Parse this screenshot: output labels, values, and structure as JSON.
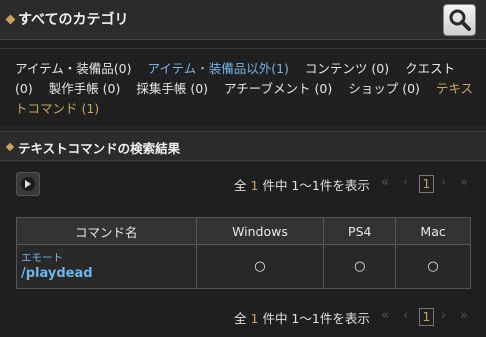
{
  "header": {
    "title": "すべてのカテゴリ",
    "search_icon": "magnifier-icon"
  },
  "categories": [
    {
      "label": "アイテム・装備品(0)"
    },
    {
      "label": "アイテム・装備品以外(1)"
    },
    {
      "label": "コンテンツ (0)"
    },
    {
      "label": "クエスト (0)"
    },
    {
      "label": "製作手帳 (0)"
    },
    {
      "label": "採集手帳 (0)"
    },
    {
      "label": "アチーブメント (0)"
    },
    {
      "label": "ショップ (0)"
    },
    {
      "label": "テキストコマンド (1)"
    }
  ],
  "results": {
    "title": "テキストコマンドの検索結果",
    "summary_prefix": "全",
    "total": "1",
    "summary_suffix": "件中 1〜1件を表示",
    "current_page": "1",
    "pager_icons": [
      "double-chevron-left-icon",
      "chevron-left-icon",
      "chevron-right-icon",
      "double-chevron-right-icon"
    ],
    "columns": [
      "コマンド名",
      "Windows",
      "PS4",
      "Mac"
    ],
    "rows": [
      {
        "category": "エモート",
        "command": "/playdead",
        "windows": "○",
        "ps4": "○",
        "mac": "○"
      }
    ]
  },
  "pager_glyphs": {
    "first": "«",
    "prev": "‹",
    "next": "›",
    "last": "»"
  }
}
